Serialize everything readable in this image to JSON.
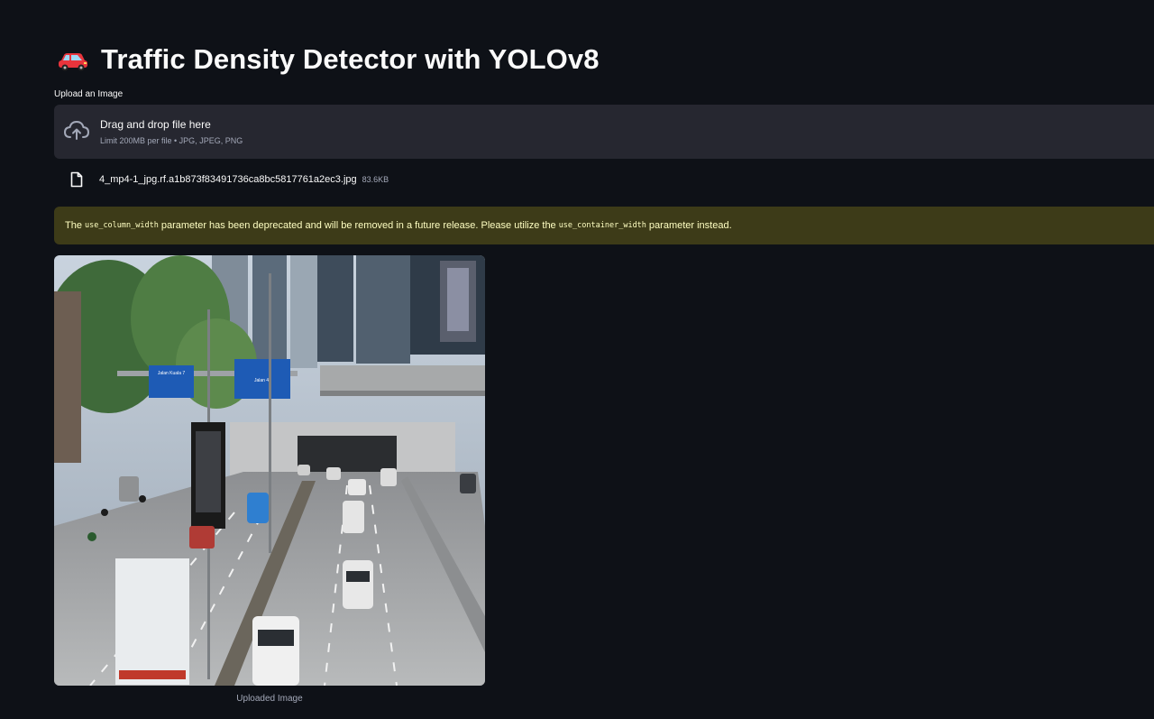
{
  "header": {
    "title": "Traffic Density Detector with YOLOv8",
    "title_icon": "car-emoji"
  },
  "uploader": {
    "label": "Upload an Image",
    "drop_title": "Drag and drop file here",
    "drop_subtitle": "Limit 200MB per file • JPG, JPEG, PNG",
    "icon": "cloud-upload-icon"
  },
  "file": {
    "name": "4_mp4-1_jpg.rf.a1b873f83491736ca8bc5817761a2ec3.jpg",
    "size": "83.6KB",
    "icon": "file-icon"
  },
  "warning": {
    "part1": "The",
    "code1": "use_column_width",
    "part2": "parameter has been deprecated and will be removed in a future release. Please utilize the",
    "code2": "use_container_width",
    "part3": "parameter instead."
  },
  "image": {
    "caption": "Uploaded Image",
    "signs": [
      "Jalan Kuala 7",
      "Jalan 4"
    ]
  },
  "colors": {
    "background": "#0e1117",
    "panel": "#262730",
    "warning_bg": "#3d3b18",
    "warning_text": "#ffffc2",
    "muted_text": "#a3a8b8"
  }
}
